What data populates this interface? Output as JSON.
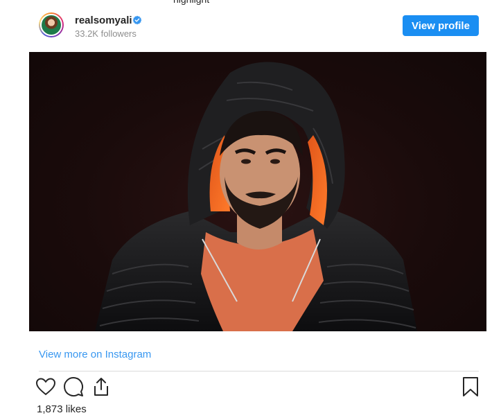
{
  "post": {
    "top_clipped_text": "highlight",
    "username": "realsomyali",
    "followers": "33.2K followers",
    "view_profile_label": "View profile",
    "view_more_label": "View more on Instagram",
    "likes": "1,873 likes"
  },
  "icons": {
    "verified": "verified-badge-icon",
    "like": "heart-icon",
    "comment": "comment-icon",
    "share": "share-icon",
    "save": "bookmark-icon"
  },
  "colors": {
    "button_blue": "#1a8ef2",
    "link_blue": "#3897f0",
    "text": "#262626",
    "muted": "#8e8e8e"
  }
}
